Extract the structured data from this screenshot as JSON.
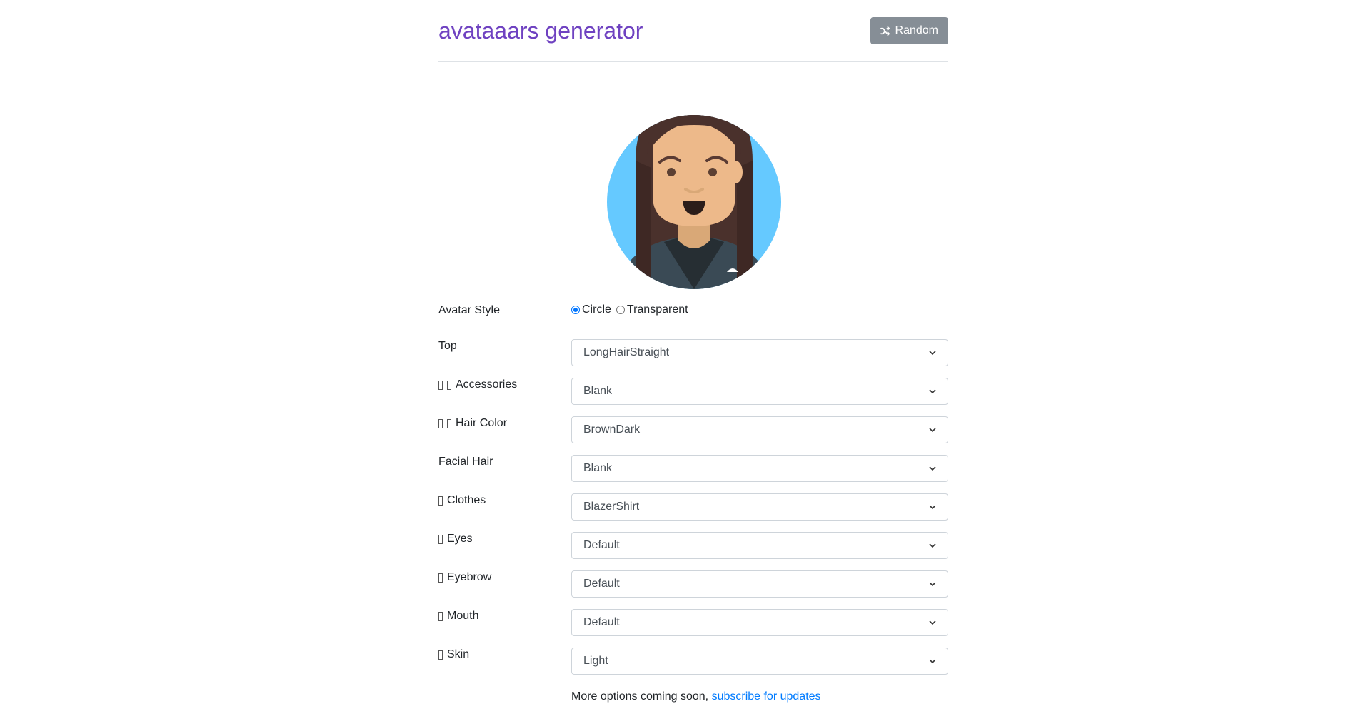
{
  "header": {
    "title": "avataaars generator",
    "random_label": "Random",
    "random_icon": "shuffle-icon"
  },
  "avatar": {
    "background_color": "#65c9ff",
    "hair_color": "#4a312c",
    "skin_color": "#edb98a",
    "clothes_color": "#262e33"
  },
  "form": {
    "avatar_style": {
      "label": "Avatar Style",
      "options": [
        "Circle",
        "Transparent"
      ],
      "selected": "Circle"
    },
    "top": {
      "label": "Top",
      "value": "LongHairStraight"
    },
    "accessories": {
      "label": "Accessories",
      "value": "Blank"
    },
    "hair_color": {
      "label": "Hair Color",
      "value": "BrownDark"
    },
    "facial_hair": {
      "label": "Facial Hair",
      "value": "Blank"
    },
    "clothes": {
      "label": "Clothes",
      "value": "BlazerShirt"
    },
    "eyes": {
      "label": "Eyes",
      "value": "Default"
    },
    "eyebrow": {
      "label": "Eyebrow",
      "value": "Default"
    },
    "mouth": {
      "label": "Mouth",
      "value": "Default"
    },
    "skin": {
      "label": "Skin",
      "value": "Light"
    }
  },
  "footer": {
    "text": "More options coming soon,",
    "link": "subscribe for updates"
  }
}
